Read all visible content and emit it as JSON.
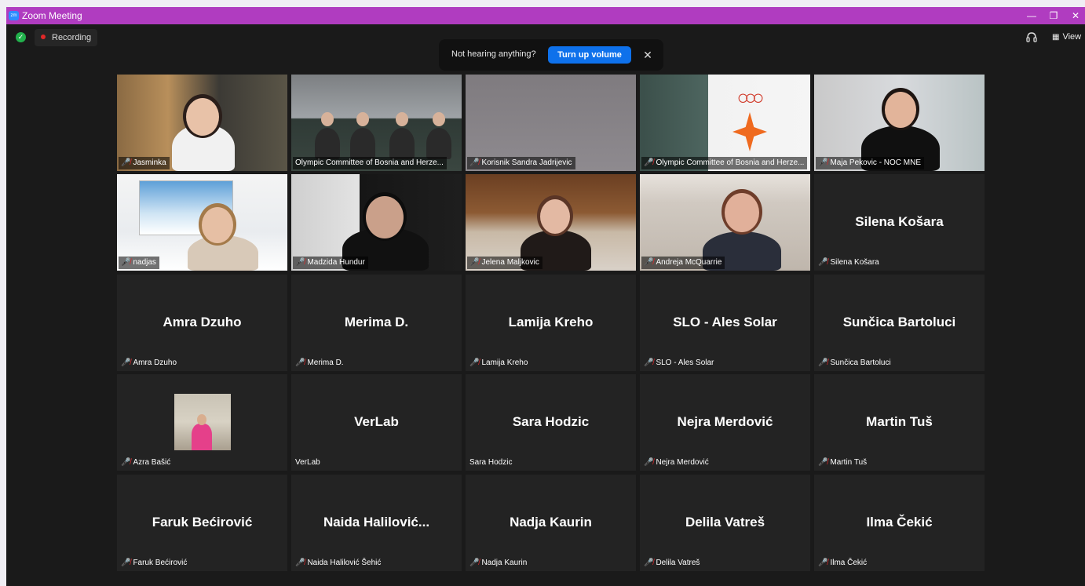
{
  "window": {
    "title": "Zoom Meeting",
    "logo_text": "zm",
    "controls": {
      "minimize": "—",
      "restore": "❐",
      "close": "✕"
    }
  },
  "toolbar": {
    "recording_label": "Recording",
    "view_label": "View",
    "view_icon": "▦",
    "security_icon": "✓",
    "headset_icon": "🎧"
  },
  "banner": {
    "text": "Not hearing anything?",
    "button_label": "Turn up volume",
    "close": "✕"
  },
  "participants": [
    {
      "label": "Jasminka",
      "display": "",
      "muted": true,
      "video": true
    },
    {
      "label": "Olympic Committee of Bosnia and Herze...",
      "display": "",
      "muted": false,
      "video": true,
      "active_speaker": true
    },
    {
      "label": "Korisnik Sandra Jadrijevic",
      "display": "",
      "muted": true,
      "video": true
    },
    {
      "label": "Olympic Committee of Bosnia and Herze...",
      "display": "",
      "muted": true,
      "video": true
    },
    {
      "label": "Maja Pekovic - NOC MNE",
      "display": "",
      "muted": true,
      "video": true
    },
    {
      "label": "nadjas",
      "display": "",
      "muted": true,
      "video": true
    },
    {
      "label": "Madzida Hundur",
      "display": "",
      "muted": true,
      "video": true
    },
    {
      "label": "Jelena Maljkovic",
      "display": "",
      "muted": true,
      "video": true
    },
    {
      "label": "Andreja McQuarrie",
      "display": "",
      "muted": true,
      "video": true
    },
    {
      "label": "Silena Košara",
      "display": "Silena Košara",
      "muted": true,
      "video": false
    },
    {
      "label": "Amra Dzuho",
      "display": "Amra Dzuho",
      "muted": true,
      "video": false
    },
    {
      "label": "Merima D.",
      "display": "Merima D.",
      "muted": true,
      "video": false
    },
    {
      "label": "Lamija Kreho",
      "display": "Lamija Kreho",
      "muted": true,
      "video": false
    },
    {
      "label": "SLO - Ales Solar",
      "display": "SLO - Ales Solar",
      "muted": true,
      "video": false
    },
    {
      "label": "Sunčica Bartoluci",
      "display": "Sunčica Bartoluci",
      "muted": true,
      "video": false
    },
    {
      "label": "Azra Bašić",
      "display": "",
      "muted": true,
      "video": false,
      "avatar": true
    },
    {
      "label": "VerLab",
      "display": "VerLab",
      "muted": false,
      "video": false
    },
    {
      "label": "Sara Hodzic",
      "display": "Sara Hodzic",
      "muted": false,
      "video": false
    },
    {
      "label": "Nejra Merdović",
      "display": "Nejra Merdović",
      "muted": true,
      "video": false
    },
    {
      "label": "Martin Tuš",
      "display": "Martin Tuš",
      "muted": true,
      "video": false
    },
    {
      "label": "Faruk Bećirović",
      "display": "Faruk Bećirović",
      "muted": true,
      "video": false
    },
    {
      "label": "Naida Halilović Šehić",
      "display": "Naida Halilović...",
      "muted": true,
      "video": false
    },
    {
      "label": "Nadja Kaurin",
      "display": "Nadja Kaurin",
      "muted": true,
      "video": false
    },
    {
      "label": "Delila Vatreš",
      "display": "Delila Vatreš",
      "muted": true,
      "video": false
    },
    {
      "label": "Ilma Čekić",
      "display": "Ilma Čekić",
      "muted": true,
      "video": false
    }
  ],
  "icons": {
    "mic_muted": "🎤̸"
  },
  "colors": {
    "title_bar": "#b03cc0",
    "accent_button": "#0e71eb",
    "active_speaker_border": "#e1e86a",
    "muted_mic": "#e0282c"
  }
}
